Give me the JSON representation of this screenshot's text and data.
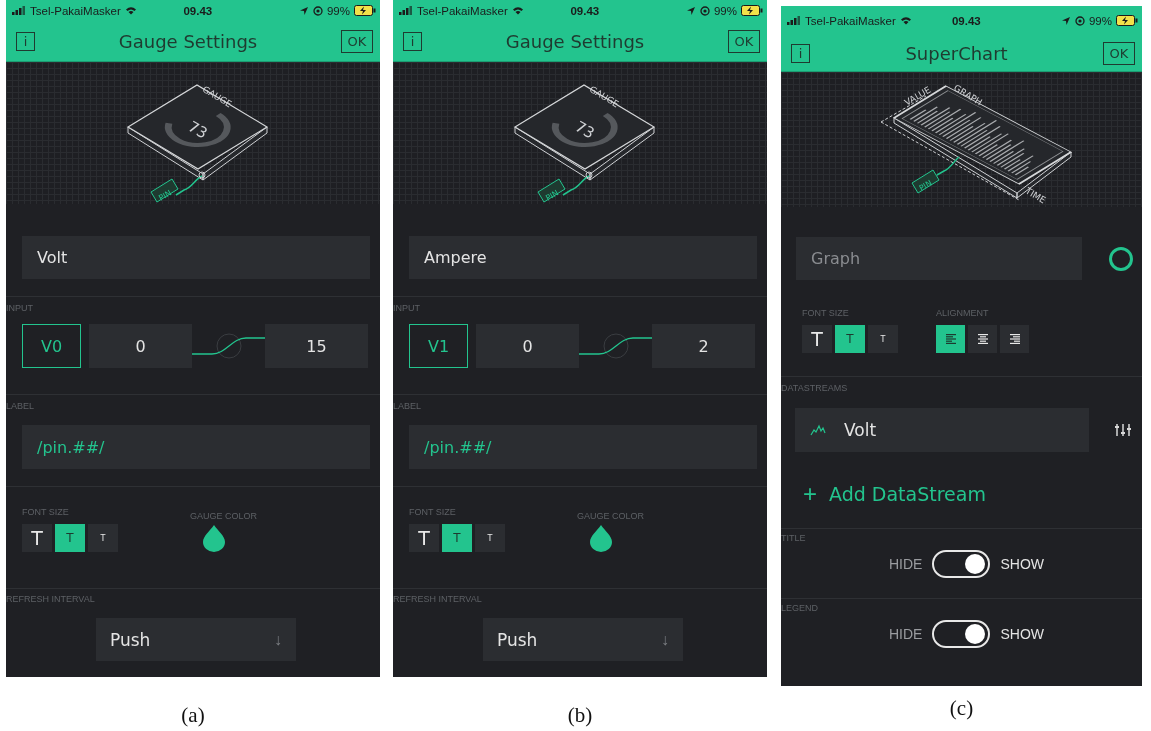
{
  "panels": [
    {
      "kind": "gauge",
      "caption": "(a)",
      "status_bar": {
        "carrier": "Tsel-PakaiMasker",
        "time": "09.43",
        "battery": "99%"
      },
      "header": {
        "info_button": "i",
        "title": "Gauge Settings",
        "ok_button": "OK"
      },
      "illustration": {
        "title": "GAUGE",
        "value": "73",
        "pin": "PIN"
      },
      "name_field": {
        "value": "Volt"
      },
      "input": {
        "label": "INPUT",
        "pin": "V0",
        "min": "0",
        "max": "15"
      },
      "label": {
        "label": "LABEL",
        "value": "/pin.##/"
      },
      "font_size": {
        "label": "FONT SIZE",
        "options": [
          {
            "text": "T",
            "selected": false
          },
          {
            "text": "T",
            "selected": true
          },
          {
            "text": "T",
            "selected": false
          }
        ]
      },
      "gauge_color": {
        "label": "GAUGE COLOR",
        "color": "#23c48e"
      },
      "refresh_interval": {
        "label": "REFRESH INTERVAL",
        "value": "Push",
        "arrow": "↓"
      }
    },
    {
      "kind": "gauge",
      "caption": "(b)",
      "status_bar": {
        "carrier": "Tsel-PakaiMasker",
        "time": "09.43",
        "battery": "99%"
      },
      "header": {
        "info_button": "i",
        "title": "Gauge Settings",
        "ok_button": "OK"
      },
      "illustration": {
        "title": "GAUGE",
        "value": "73",
        "pin": "PIN"
      },
      "name_field": {
        "value": "Ampere"
      },
      "input": {
        "label": "INPUT",
        "pin": "V1",
        "min": "0",
        "max": "2"
      },
      "label": {
        "label": "LABEL",
        "value": "/pin.##/"
      },
      "font_size": {
        "label": "FONT SIZE",
        "options": [
          {
            "text": "T",
            "selected": false
          },
          {
            "text": "T",
            "selected": true
          },
          {
            "text": "T",
            "selected": false
          }
        ]
      },
      "gauge_color": {
        "label": "GAUGE COLOR",
        "color": "#23c48e"
      },
      "refresh_interval": {
        "label": "REFRESH INTERVAL",
        "value": "Push",
        "arrow": "↓"
      }
    },
    {
      "kind": "superchart",
      "caption": "(c)",
      "status_bar": {
        "carrier": "Tsel-PakaiMasker",
        "time": "09.43",
        "battery": "99%"
      },
      "header": {
        "info_button": "i",
        "title": "SuperChart",
        "ok_button": "OK"
      },
      "illustration": {
        "title": "GRAPH",
        "y_axis": "VALUE",
        "x_axis": "TIME",
        "pin": "PIN"
      },
      "name_field": {
        "placeholder": "Graph"
      },
      "color_picker": {
        "color": "#23c48e"
      },
      "font_size": {
        "label": "FONT SIZE",
        "options": [
          {
            "text": "T",
            "selected": false
          },
          {
            "text": "T",
            "selected": true
          },
          {
            "text": "T",
            "selected": false
          }
        ]
      },
      "alignment": {
        "label": "ALIGNMENT",
        "options": [
          {
            "kind": "left",
            "selected": true
          },
          {
            "kind": "center",
            "selected": false
          },
          {
            "kind": "right",
            "selected": false
          }
        ]
      },
      "datastreams": {
        "label": "DATASTREAMS",
        "items": [
          {
            "name": "Volt"
          }
        ],
        "add_icon": "+",
        "add": "Add DataStream"
      },
      "toggles": [
        {
          "label": "TITLE",
          "off_text": "HIDE",
          "on_text": "SHOW",
          "on": true
        },
        {
          "label": "LEGEND",
          "off_text": "HIDE",
          "on_text": "SHOW",
          "on": true
        }
      ]
    }
  ]
}
